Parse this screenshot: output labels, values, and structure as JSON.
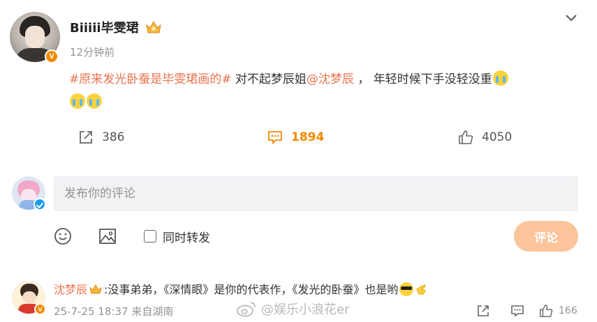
{
  "post": {
    "username": "Biiiii毕雯珺",
    "timestamp": "12分钟前",
    "content": {
      "topic": "#原来发光卧蚕是毕雯珺画的#",
      "text1": " 对不起梦辰姐",
      "mention": "@沈梦辰",
      "text2": " ， 年轻时候下手没轻没重"
    },
    "actions": {
      "repost_count": "386",
      "comment_count": "1894",
      "like_count": "4050"
    }
  },
  "comment_box": {
    "placeholder": "发布你的评论",
    "repost_label": "同时转发",
    "submit_label": "评论"
  },
  "reply": {
    "username": "沈梦辰",
    "text": ":没事弟弟，《深情眼》是你的代表作，《发光的卧蚕》也是哟",
    "date": "25-7-25 18:37",
    "location": "来自湖南",
    "like_count": "166"
  },
  "watermark": "@娱乐小浪花er",
  "colors": {
    "accent_orange": "#f28a00",
    "link_color": "#eb7350",
    "submit_bg": "#fbc49a",
    "muted_text": "#939393"
  }
}
